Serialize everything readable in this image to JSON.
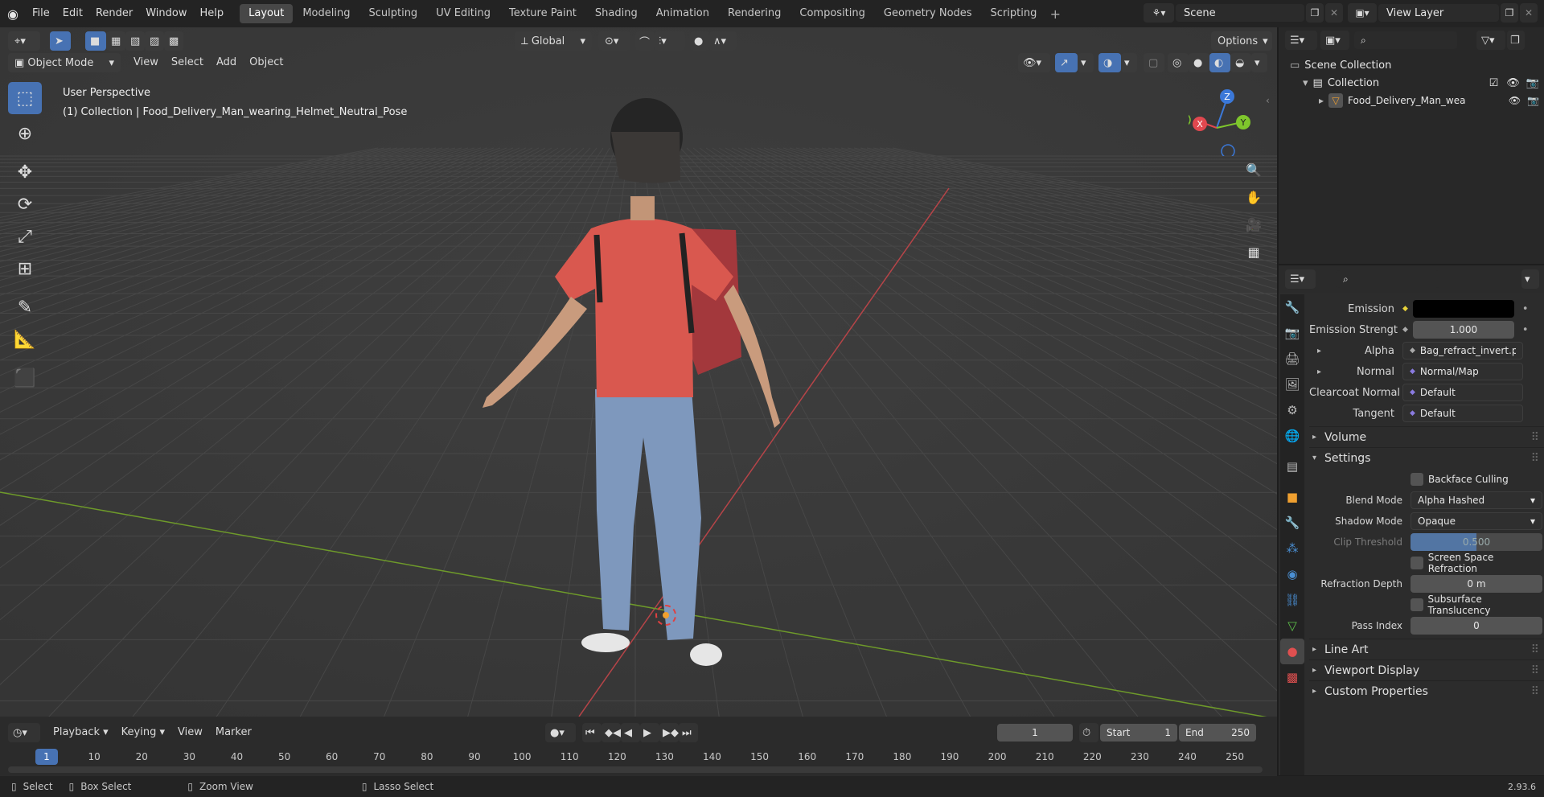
{
  "topbar": {
    "menus": [
      "File",
      "Edit",
      "Render",
      "Window",
      "Help"
    ],
    "workspaces": [
      "Layout",
      "Modeling",
      "Sculpting",
      "UV Editing",
      "Texture Paint",
      "Shading",
      "Animation",
      "Rendering",
      "Compositing",
      "Geometry Nodes",
      "Scripting"
    ],
    "active_workspace": "Layout",
    "scene": "Scene",
    "view_layer": "View Layer"
  },
  "viewport": {
    "mode": "Object Mode",
    "menus": [
      "View",
      "Select",
      "Add",
      "Object"
    ],
    "orientation": "Global",
    "options_label": "Options",
    "overlay_title": "User Perspective",
    "overlay_subtitle": "(1) Collection | Food_Delivery_Man_wearing_Helmet_Neutral_Pose",
    "gizmo_axes": [
      "Z",
      "X",
      "Y"
    ]
  },
  "outliner": {
    "root": "Scene Collection",
    "collection": "Collection",
    "object": "Food_Delivery_Man_wea"
  },
  "properties": {
    "emission_label": "Emission",
    "emission_color": "#000000",
    "emission_strength_label": "Emission Strengt",
    "emission_strength_value": "1.000",
    "alpha_label": "Alpha",
    "alpha_value": "Bag_refract_invert.p...",
    "normal_label": "Normal",
    "normal_value": "Normal/Map",
    "clearcoat_label": "Clearcoat Normal",
    "clearcoat_value": "Default",
    "tangent_label": "Tangent",
    "tangent_value": "Default",
    "volume_label": "Volume",
    "settings_label": "Settings",
    "backface_label": "Backface Culling",
    "blend_mode_label": "Blend Mode",
    "blend_mode_value": "Alpha Hashed",
    "shadow_mode_label": "Shadow Mode",
    "shadow_mode_value": "Opaque",
    "clip_threshold_label": "Clip Threshold",
    "clip_threshold_value": "0.500",
    "ssr_label": "Screen Space Refraction",
    "refraction_depth_label": "Refraction Depth",
    "refraction_depth_value": "0 m",
    "subsurface_label": "Subsurface Translucency",
    "pass_index_label": "Pass Index",
    "pass_index_value": "0",
    "line_art_label": "Line Art",
    "viewport_display_label": "Viewport Display",
    "custom_props_label": "Custom Properties"
  },
  "timeline": {
    "menus": [
      "Playback",
      "Keying",
      "View",
      "Marker"
    ],
    "current_frame": "1",
    "start_label": "Start",
    "start_value": "1",
    "end_label": "End",
    "end_value": "250",
    "ruler": [
      "1",
      "10",
      "20",
      "30",
      "40",
      "50",
      "60",
      "70",
      "80",
      "90",
      "100",
      "110",
      "120",
      "130",
      "140",
      "150",
      "160",
      "170",
      "180",
      "190",
      "200",
      "210",
      "220",
      "230",
      "240",
      "250"
    ]
  },
  "statusbar": {
    "select": "Select",
    "box_select": "Box Select",
    "zoom_view": "Zoom View",
    "lasso_select": "Lasso Select",
    "version": "2.93.6"
  },
  "colors": {
    "accent": "#4772b3",
    "x_axis": "#e0484f",
    "y_axis": "#7ec62c",
    "z_axis": "#3b78d8"
  }
}
